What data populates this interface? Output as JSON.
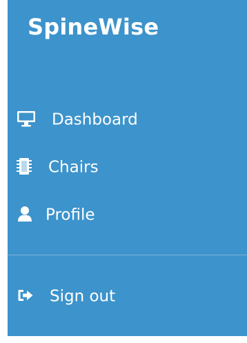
{
  "app": {
    "brand": "SpineWise"
  },
  "sidebar": {
    "items": [
      {
        "label": "Dashboard",
        "icon": "monitor-icon"
      },
      {
        "label": "Chairs",
        "icon": "chip-icon"
      },
      {
        "label": "Profile",
        "icon": "user-icon"
      }
    ],
    "footer": {
      "label": "Sign out",
      "icon": "sign-out-icon"
    }
  },
  "colors": {
    "sidebar_background": "#3d93cb",
    "text": "#ffffff"
  }
}
